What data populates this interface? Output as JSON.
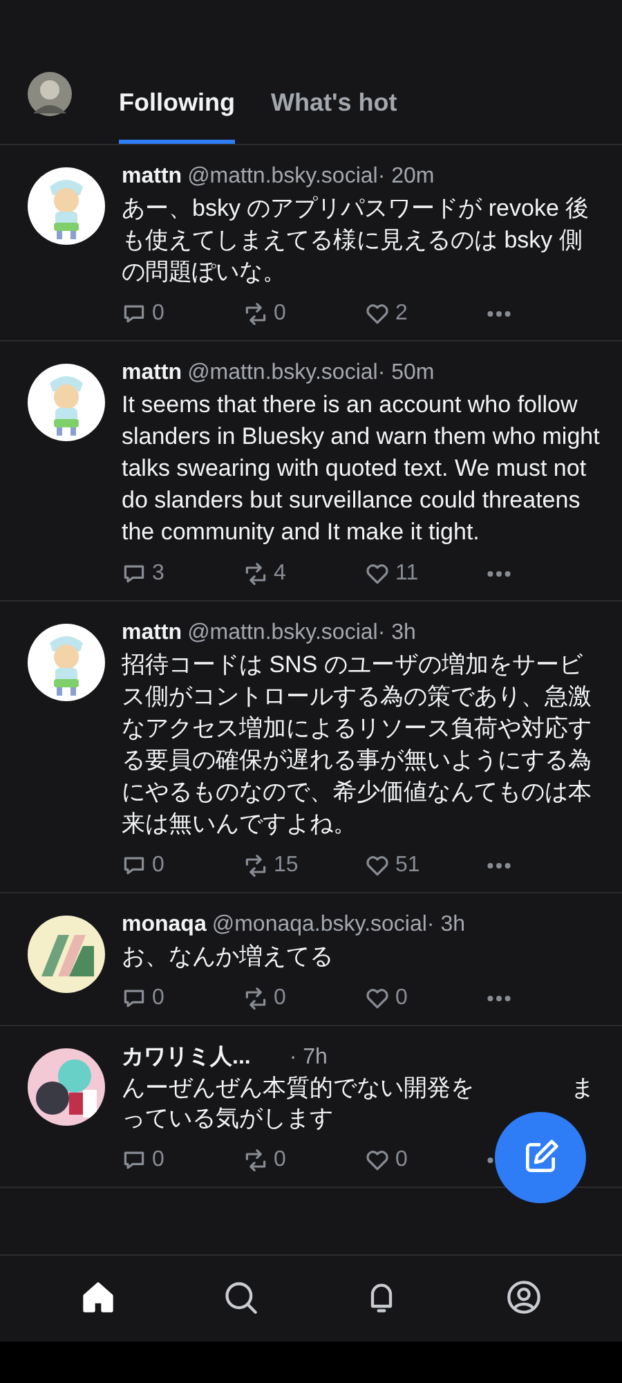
{
  "header": {
    "tabs": [
      {
        "label": "Following",
        "selected": true
      },
      {
        "label": "What's hot",
        "selected": false
      }
    ]
  },
  "posts": [
    {
      "name": "mattn",
      "handle": "@mattn.bsky.social",
      "time": "· 20m",
      "body": [
        "あー、bsky のアプリパスワードが revoke 後も使えてしまえてる様に見えるのは bsky 側の問題ぽいな。"
      ],
      "replies": "0",
      "reposts": "0",
      "likes": "2"
    },
    {
      "name": "mattn",
      "handle": "@mattn.bsky.social",
      "time": "· 50m",
      "body": [
        "It seems that there is an account who follow slanders in Bluesky and warn them who might talks swearing with quoted text. We must not do slanders but surveillance could threatens the community and It make it tight."
      ],
      "replies": "3",
      "reposts": "4",
      "likes": "11"
    },
    {
      "name": "mattn",
      "handle": "@mattn.bsky.social",
      "time": "· 3h",
      "body": [
        "招待コードは SNS のユーザの増加をサービス側がコントロールする為の策であり、急激なアクセス増加によるリソース負荷や対応する要員の確保が遅れる事が無いようにする為にやるものなので、希少価値なんてものは本来は無いんですよね。"
      ],
      "replies": "0",
      "reposts": "15",
      "likes": "51"
    },
    {
      "name": "monaqa",
      "handle": "@monaqa.bsky.social",
      "time": "· 3h",
      "body": [
        "お、なんか増えてる"
      ],
      "replies": "0",
      "reposts": "0",
      "likes": "0"
    },
    {
      "name": "カワリミ人...",
      "time": "· 7h",
      "body": [
        "んーぜんぜん本質的でない開発を",
        "ま",
        "っている気がします"
      ],
      "replies": "0",
      "reposts": "0",
      "likes": "0"
    }
  ],
  "nav": [
    {
      "selected": true
    },
    {
      "selected": false
    },
    {
      "selected": false
    },
    {
      "selected": false
    }
  ]
}
